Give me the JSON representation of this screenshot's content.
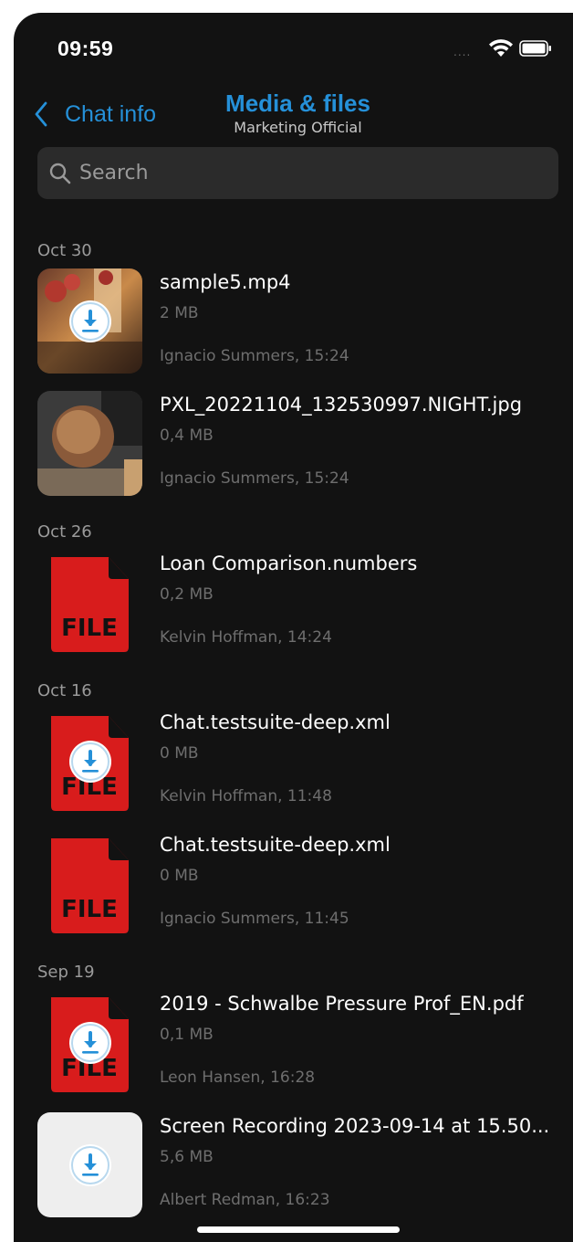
{
  "status_bar": {
    "time": "09:59",
    "signal_dots": "....",
    "icons": [
      "wifi-icon",
      "battery-icon"
    ]
  },
  "nav": {
    "back_label": "Chat info",
    "title": "Media & files",
    "subtitle": "Marketing Official"
  },
  "search": {
    "placeholder": "Search",
    "value": ""
  },
  "colors": {
    "accent": "#2590d8",
    "background": "#121212",
    "search_bg": "#2b2b2b",
    "file_red": "#d81c1c",
    "secondary_text": "#6e6e6e"
  },
  "sections": [
    {
      "date": "Oct 30",
      "items": [
        {
          "name": "sample5.mp4",
          "size": "2 MB",
          "meta": "Ignacio Summers, 15:24",
          "thumb": "video-photo",
          "download": true
        },
        {
          "name": "PXL_20221104_132530997.NIGHT.jpg",
          "size": "0,4 MB",
          "meta": "Ignacio Summers, 15:24",
          "thumb": "night-photo",
          "download": false
        }
      ]
    },
    {
      "date": "Oct 26",
      "items": [
        {
          "name": "Loan Comparison.numbers",
          "size": "0,2 MB",
          "meta": "Kelvin Hoffman, 14:24",
          "thumb": "file",
          "download": false
        }
      ]
    },
    {
      "date": "Oct 16",
      "items": [
        {
          "name": "Chat.testsuite-deep.xml",
          "size": "0 MB",
          "meta": "Kelvin Hoffman, 11:48",
          "thumb": "file",
          "download": true
        },
        {
          "name": "Chat.testsuite-deep.xml",
          "size": "0 MB",
          "meta": "Ignacio Summers, 11:45",
          "thumb": "file",
          "download": false
        }
      ]
    },
    {
      "date": "Sep 19",
      "items": [
        {
          "name": "2019 - Schwalbe Pressure Prof_EN.pdf",
          "size": "0,1 MB",
          "meta": "Leon Hansen, 16:28",
          "thumb": "file",
          "download": true
        },
        {
          "name": "Screen Recording 2023-09-14 at 15.50...",
          "size": "5,6 MB",
          "meta": "Albert Redman, 16:23",
          "thumb": "blank",
          "download": true
        }
      ]
    }
  ],
  "file_icon_label": "FILE"
}
